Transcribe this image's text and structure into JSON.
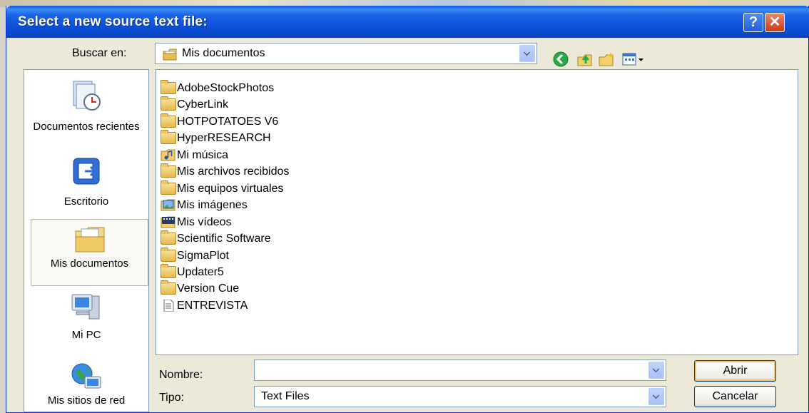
{
  "window": {
    "title": "Select a new source text file:",
    "help_glyph": "?",
    "close_glyph": "✕"
  },
  "lookin": {
    "label": "Buscar en:",
    "value": "Mis documentos",
    "icon": "my-documents-icon"
  },
  "toolbar": {
    "back_icon": "back-icon",
    "up_icon": "up-folder-icon",
    "new_folder_icon": "new-folder-icon",
    "view_menu_icon": "view-menu-icon"
  },
  "places": [
    {
      "label": "Documentos recientes",
      "icon": "recent-documents-icon"
    },
    {
      "label": "Escritorio",
      "icon": "desktop-icon"
    },
    {
      "label": "Mis documentos",
      "icon": "my-documents-icon",
      "selected": true
    },
    {
      "label": "Mi PC",
      "icon": "my-computer-icon"
    },
    {
      "label": "Mis sitios de red",
      "icon": "network-places-icon"
    }
  ],
  "files": [
    {
      "name": "AdobeStockPhotos",
      "icon": "folder-icon"
    },
    {
      "name": "CyberLink",
      "icon": "folder-icon"
    },
    {
      "name": "HOTPOTATOES V6",
      "icon": "folder-icon"
    },
    {
      "name": "HyperRESEARCH",
      "icon": "folder-icon"
    },
    {
      "name": "Mi música",
      "icon": "music-folder-icon"
    },
    {
      "name": "Mis archivos recibidos",
      "icon": "folder-icon"
    },
    {
      "name": "Mis equipos virtuales",
      "icon": "folder-icon"
    },
    {
      "name": "Mis imágenes",
      "icon": "pictures-folder-icon"
    },
    {
      "name": "Mis vídeos",
      "icon": "videos-folder-icon"
    },
    {
      "name": "Scientific Software",
      "icon": "folder-icon"
    },
    {
      "name": "SigmaPlot",
      "icon": "folder-icon"
    },
    {
      "name": "Updater5",
      "icon": "folder-icon"
    },
    {
      "name": "Version Cue",
      "icon": "folder-icon"
    },
    {
      "name": "ENTREVISTA",
      "icon": "text-file-icon"
    }
  ],
  "filename": {
    "label": "Nombre:",
    "value": ""
  },
  "filetype": {
    "label": "Tipo:",
    "value": "Text Files"
  },
  "buttons": {
    "open": "Abrir",
    "cancel": "Cancelar"
  }
}
